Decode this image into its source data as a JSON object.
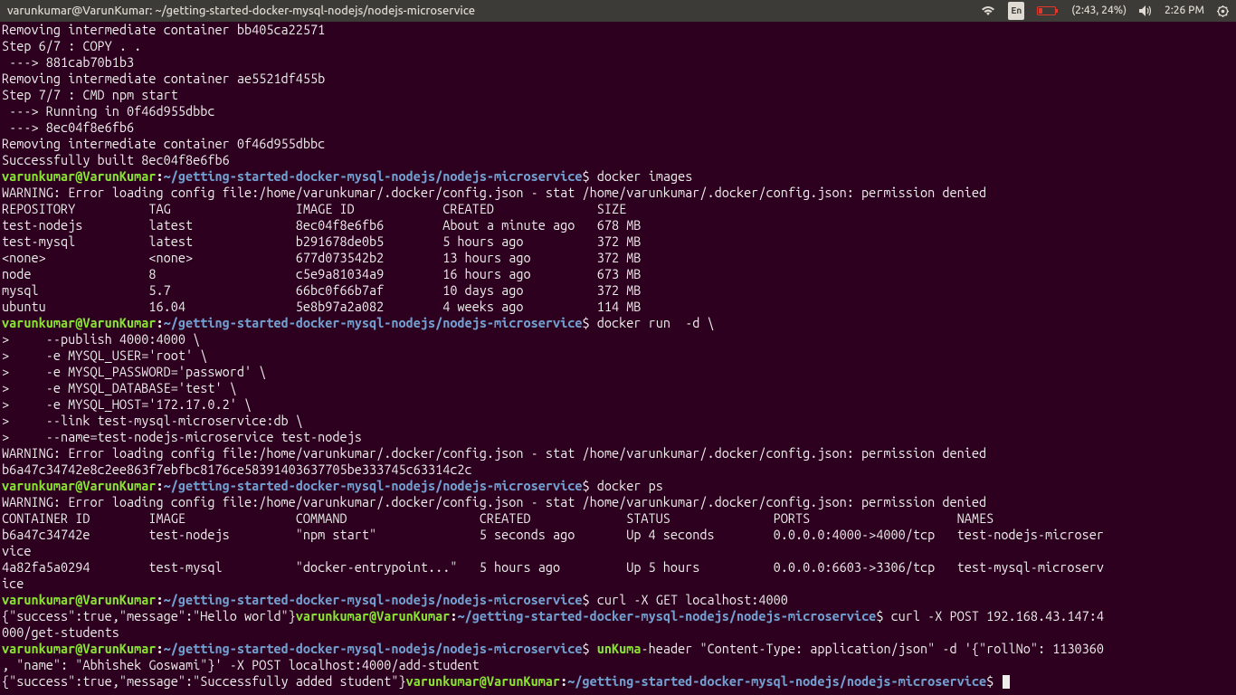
{
  "window": {
    "title": "varunkumar@VarunKumar: ~/getting-started-docker-mysql-nodejs/nodejs-microservice"
  },
  "tray": {
    "lang": "En",
    "battery": "(2:43, 24%)",
    "time": "2:26 PM"
  },
  "prompt": {
    "user": "varunkumar@VarunKumar",
    "path": "~/getting-started-docker-mysql-nodejs/nodejs-microservice",
    "sym": "$"
  },
  "build_output": [
    "Removing intermediate container bb405ca22571",
    "Step 6/7 : COPY . .",
    " ---> 881cab70b1b3",
    "Removing intermediate container ae5521df455b",
    "Step 7/7 : CMD npm start",
    " ---> Running in 0f46d955dbbc",
    " ---> 8ec04f8e6fb6",
    "Removing intermediate container 0f46d955dbbc",
    "Successfully built 8ec04f8e6fb6"
  ],
  "cmd1": "docker images",
  "warning": "WARNING: Error loading config file:/home/varunkumar/.docker/config.json - stat /home/varunkumar/.docker/config.json: permission denied",
  "images_header": "REPOSITORY          TAG                 IMAGE ID            CREATED              SIZE",
  "images_rows": [
    "test-nodejs         latest              8ec04f8e6fb6        About a minute ago   678 MB",
    "test-mysql          latest              b291678de0b5        5 hours ago          372 MB",
    "<none>              <none>              677d073542b2        13 hours ago         372 MB",
    "node                8                   c5e9a81034a9        16 hours ago         673 MB",
    "mysql               5.7                 66bc0f66b7af        10 days ago          372 MB",
    "ubuntu              16.04               5e8b97a2a082        4 weeks ago          114 MB"
  ],
  "cmd2": "docker run  -d \\",
  "cmd2_cont": [
    ">     --publish 4000:4000 \\",
    ">     -e MYSQL_USER='root' \\",
    ">     -e MYSQL_PASSWORD='password' \\",
    ">     -e MYSQL_DATABASE='test' \\",
    ">     -e MYSQL_HOST='172.17.0.2' \\",
    ">     --link test-mysql-microservice:db \\",
    ">     --name=test-nodejs-microservice test-nodejs"
  ],
  "run_hash": "b6a47c34742e8c2ee863f7ebfbc8176ce58391403637705be333745c63314c2c",
  "cmd3": "docker ps",
  "ps_header": "CONTAINER ID        IMAGE               COMMAND                  CREATED             STATUS              PORTS                    NAMES",
  "ps_rows": [
    "b6a47c34742e        test-nodejs         \"npm start\"              5 seconds ago       Up 4 seconds        0.0.0.0:4000->4000/tcp   test-nodejs-microser\nvice",
    "4a82fa5a0294        test-mysql          \"docker-entrypoint...\"   5 hours ago         Up 5 hours          0.0.0.0:6603->3306/tcp   test-mysql-microserv\nice"
  ],
  "cmd4": "curl -X GET localhost:4000",
  "curl1_out": "{\"success\":true,\"message\":\"Hello world\"}",
  "cmd5a": "curl -X POST 192.168.43.147:4",
  "cmd5b": "000/get-students",
  "cmd6a": "unKuma",
  "cmd6b": "-header \"Content-Type: application/json\" -d '{\"rollNo\": 1130360",
  "cmd6c": ", \"name\": \"Abhishek Goswami\"}' -X POST localhost:4000/add-student",
  "curl2_out": "{\"success\":true,\"message\":\"Successfully added student\"}"
}
